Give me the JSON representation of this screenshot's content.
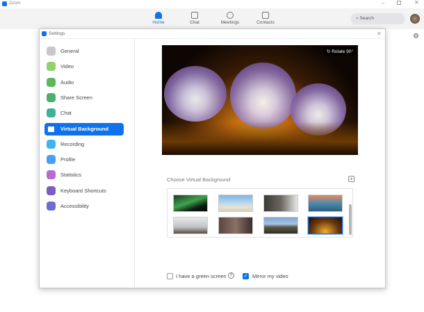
{
  "app": {
    "title": "Zoom",
    "accent": "#0e72ed"
  },
  "window_controls": [
    "minimize",
    "maximize",
    "close"
  ],
  "nav": {
    "items": [
      {
        "label": "Home",
        "icon": "home-icon",
        "active": true
      },
      {
        "label": "Chat",
        "icon": "chat-icon"
      },
      {
        "label": "Meetings",
        "icon": "clock-icon"
      },
      {
        "label": "Contacts",
        "icon": "contacts-icon"
      }
    ],
    "search_placeholder": "Search"
  },
  "settings": {
    "title": "Settings",
    "sidebar": [
      {
        "label": "General",
        "color": "#c8c8c8"
      },
      {
        "label": "Video",
        "color": "#8fd16a"
      },
      {
        "label": "Audio",
        "color": "#5cb85c"
      },
      {
        "label": "Share Screen",
        "color": "#4caf6a"
      },
      {
        "label": "Chat",
        "color": "#3bb29a"
      },
      {
        "label": "Virtual Background",
        "color": "#ffffff",
        "active": true
      },
      {
        "label": "Recording",
        "color": "#3fb3f0"
      },
      {
        "label": "Profile",
        "color": "#4a9ff0"
      },
      {
        "label": "Statistics",
        "color": "#b86ad0"
      },
      {
        "label": "Keyboard Shortcuts",
        "color": "#7b5fc0"
      },
      {
        "label": "Accessibility",
        "color": "#6c6fd0"
      }
    ],
    "rotate_label": "Rotate 90°",
    "choose_label": "Choose Virtual Background",
    "thumbnails": [
      "Northern lights",
      "Beach",
      "Abstract interior",
      "Golden Gate Bridge",
      "Office",
      "Library",
      "Castle",
      "Lamps (selected)"
    ],
    "green_screen_label": "I have a green screen",
    "green_screen_checked": false,
    "mirror_label": "Mirror my video",
    "mirror_checked": true
  }
}
